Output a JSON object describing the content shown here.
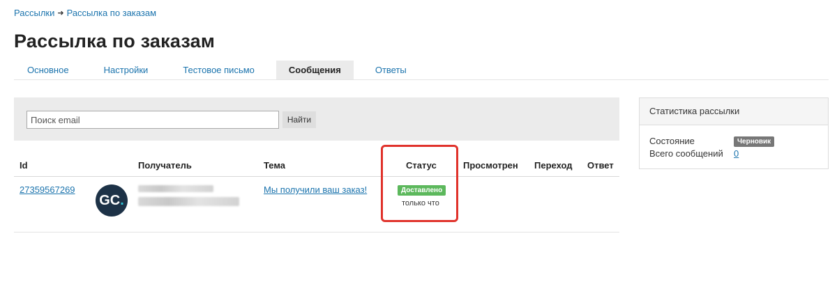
{
  "breadcrumb": {
    "root": "Рассылки",
    "separator": "➜",
    "current": "Рассылка по заказам"
  },
  "page": {
    "title": "Рассылка по заказам"
  },
  "tabs": [
    {
      "label": "Основное"
    },
    {
      "label": "Настройки"
    },
    {
      "label": "Тестовое письмо"
    },
    {
      "label": "Сообщения",
      "active": true
    },
    {
      "label": "Ответы"
    }
  ],
  "search": {
    "placeholder": "Поиск email",
    "value": "",
    "button_label": "Найти"
  },
  "table": {
    "columns": [
      "Id",
      "Получатель",
      "Тема",
      "Статус",
      "Просмотрен",
      "Переход",
      "Ответ"
    ],
    "rows": [
      {
        "id": "27359567269",
        "avatar": "GC.",
        "subject": "Мы получили ваш заказ!",
        "status": "Доставлено",
        "status_time": "только что",
        "viewed": "",
        "clicked": "",
        "replied": ""
      }
    ]
  },
  "stats": {
    "title": "Статистика рассылки",
    "state_label": "Состояние",
    "state_value": "Черновик",
    "total_label": "Всего сообщений",
    "total_value": "0"
  },
  "colors": {
    "link": "#1a73ad",
    "success": "#5cb85c",
    "highlight": "#e0322b",
    "draft": "#777777"
  }
}
